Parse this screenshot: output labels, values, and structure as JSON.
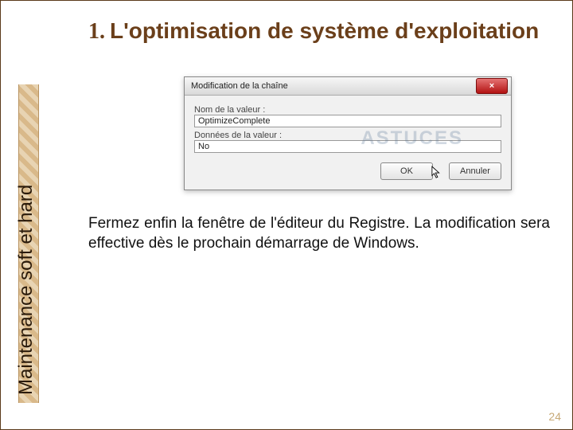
{
  "sidebar": {
    "label": "Maintenance soft et hard"
  },
  "heading": {
    "number": "1.",
    "text": "L'optimisation de système d'exploitation"
  },
  "dialog": {
    "title": "Modification de la chaîne",
    "name_label": "Nom de la valeur :",
    "name_value": "OptimizeComplete",
    "data_label": "Données de la valeur :",
    "data_value": "No",
    "ok_label": "OK",
    "cancel_label": "Annuler",
    "close_label": "×",
    "watermark": "ASTUCES"
  },
  "paragraph": "Fermez enfin la fenêtre de l'éditeur du Registre. La modification sera effective dès le prochain démarrage de Windows.",
  "page_number": "24"
}
